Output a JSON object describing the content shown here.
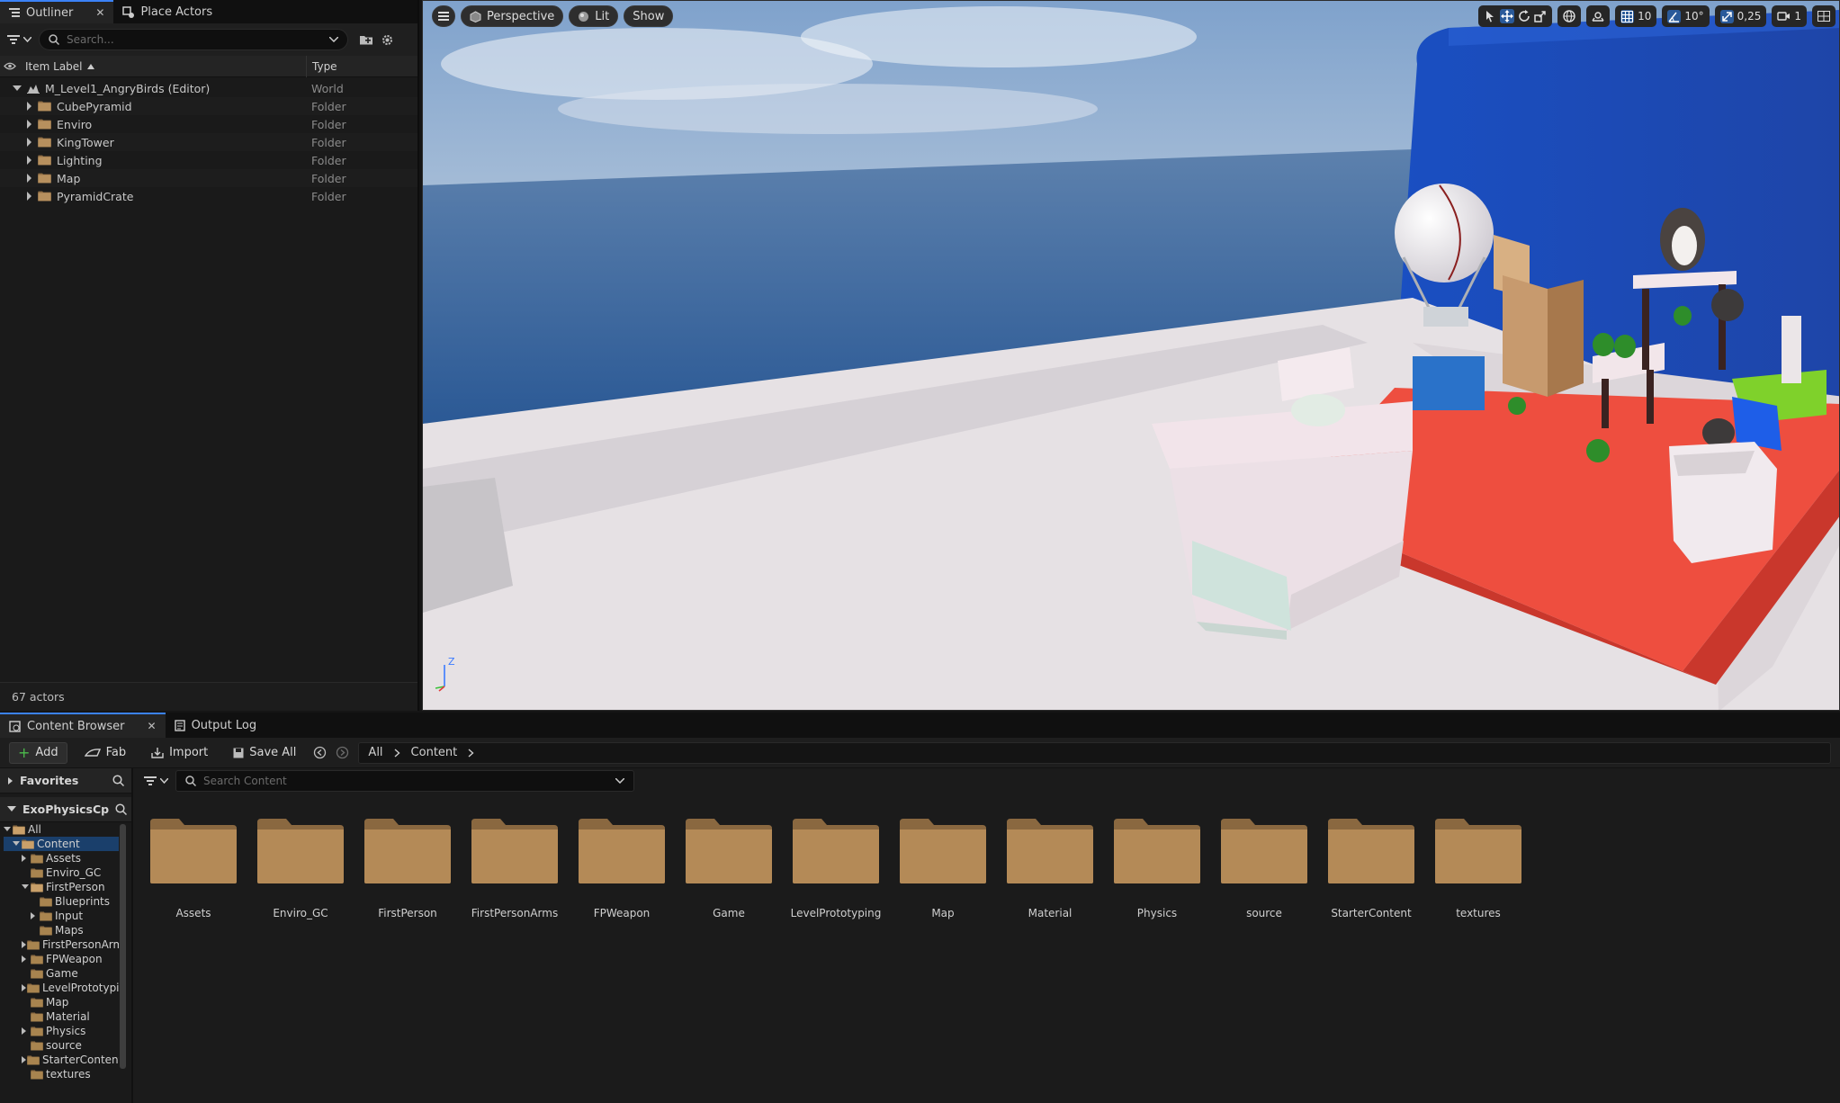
{
  "outliner": {
    "tabs": [
      {
        "label": "Outliner",
        "active": true
      },
      {
        "label": "Place Actors",
        "active": false
      }
    ],
    "search_placeholder": "Search...",
    "columns": {
      "label": "Item Label",
      "type": "Type"
    },
    "items": [
      {
        "label": "M_Level1_AngryBirds (Editor)",
        "type": "World",
        "level": 0,
        "expanded": true,
        "icon": "world-icon"
      },
      {
        "label": "CubePyramid",
        "type": "Folder",
        "level": 1,
        "icon": "folder-icon"
      },
      {
        "label": "Enviro",
        "type": "Folder",
        "level": 1,
        "icon": "folder-icon"
      },
      {
        "label": "KingTower",
        "type": "Folder",
        "level": 1,
        "icon": "folder-icon"
      },
      {
        "label": "Lighting",
        "type": "Folder",
        "level": 1,
        "icon": "folder-icon"
      },
      {
        "label": "Map",
        "type": "Folder",
        "level": 1,
        "icon": "folder-icon"
      },
      {
        "label": "PyramidCrate",
        "type": "Folder",
        "level": 1,
        "icon": "folder-icon"
      }
    ],
    "status": "67 actors"
  },
  "viewport": {
    "buttons": {
      "perspective": "Perspective",
      "lit": "Lit",
      "show": "Show"
    },
    "right_toolbar": {
      "grid_snap": "10",
      "rotation_snap": "10°",
      "scale_snap": "0,25",
      "camera_speed": "1"
    },
    "gizmo": {
      "z": "Z"
    }
  },
  "content_browser": {
    "tabs": [
      {
        "label": "Content Browser",
        "active": true
      },
      {
        "label": "Output Log",
        "active": false
      }
    ],
    "toolbar": {
      "add": "Add",
      "fab": "Fab",
      "import": "Import",
      "save_all": "Save All"
    },
    "breadcrumb": [
      "All",
      "Content"
    ],
    "favorites": "Favorites",
    "project": "ExoPhysicsCp",
    "search_placeholder": "Search Content",
    "tree": [
      {
        "label": "All",
        "level": 0,
        "expanded": true,
        "open": true
      },
      {
        "label": "Content",
        "level": 1,
        "expanded": true,
        "open": true,
        "selected": true
      },
      {
        "label": "Assets",
        "level": 2,
        "arrow": true
      },
      {
        "label": "Enviro_GC",
        "level": 2
      },
      {
        "label": "FirstPerson",
        "level": 2,
        "expanded": true,
        "open": true
      },
      {
        "label": "Blueprints",
        "level": 3
      },
      {
        "label": "Input",
        "level": 3,
        "arrow": true
      },
      {
        "label": "Maps",
        "level": 3
      },
      {
        "label": "FirstPersonArms",
        "level": 2,
        "arrow": true
      },
      {
        "label": "FPWeapon",
        "level": 2,
        "arrow": true
      },
      {
        "label": "Game",
        "level": 2
      },
      {
        "label": "LevelPrototyping",
        "level": 2,
        "arrow": true
      },
      {
        "label": "Map",
        "level": 2
      },
      {
        "label": "Material",
        "level": 2
      },
      {
        "label": "Physics",
        "level": 2,
        "arrow": true
      },
      {
        "label": "source",
        "level": 2
      },
      {
        "label": "StarterContent",
        "level": 2,
        "arrow": true
      },
      {
        "label": "textures",
        "level": 2
      }
    ],
    "folders": [
      "Assets",
      "Enviro_GC",
      "FirstPerson",
      "FirstPersonArms",
      "FPWeapon",
      "Game",
      "LevelPrototyping",
      "Map",
      "Material",
      "Physics",
      "source",
      "StarterContent",
      "textures"
    ]
  }
}
